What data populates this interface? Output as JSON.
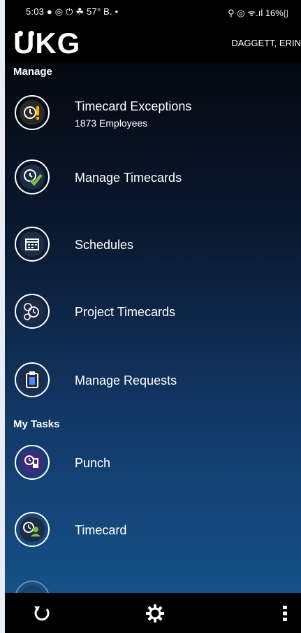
{
  "status": {
    "left_text": "5:03 ● ◎ ⏻ ☘ 57° B. •",
    "right_text": "⚲ ◎ ᯤ.ıl 16%▯"
  },
  "header": {
    "logo_text": "UKG",
    "user": "DAGGETT, ERIN"
  },
  "sections": {
    "manage": "Manage",
    "mytasks": "My Tasks"
  },
  "manage_items": [
    {
      "label": "Timecard Exceptions",
      "sub": "1873 Employees",
      "icon": "timecard-exceptions-icon"
    },
    {
      "label": "Manage Timecards",
      "icon": "manage-timecards-icon"
    },
    {
      "label": "Schedules",
      "icon": "calendar-icon"
    },
    {
      "label": "Project Timecards",
      "icon": "project-timecards-icon"
    },
    {
      "label": "Manage Requests",
      "icon": "requests-icon"
    }
  ],
  "task_items": [
    {
      "label": "Punch",
      "icon": "punch-icon"
    },
    {
      "label": "Timecard",
      "icon": "timecard-icon"
    }
  ],
  "bottom": {
    "refresh": "refresh-icon",
    "settings": "gear-icon",
    "more": "more-vert-icon"
  }
}
